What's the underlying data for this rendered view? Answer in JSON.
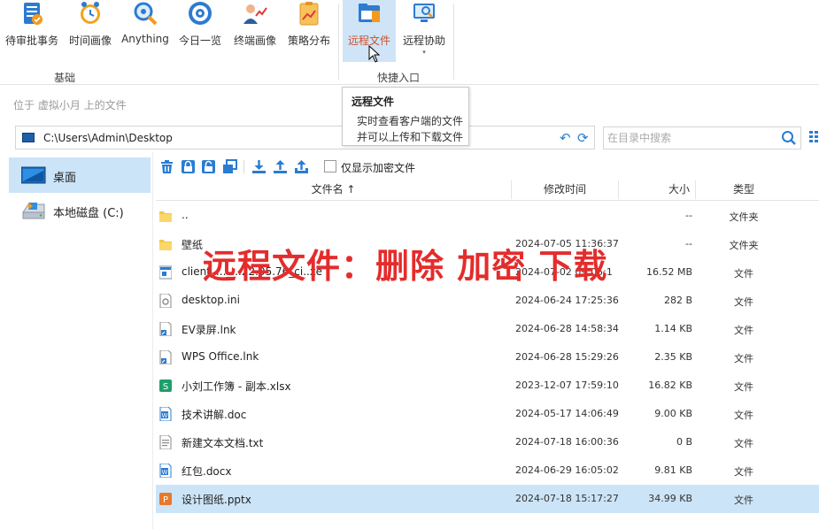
{
  "ribbon": {
    "buttons": [
      {
        "label": "待审批事务",
        "icon": "approval-icon"
      },
      {
        "label": "时间画像",
        "icon": "clock-icon"
      },
      {
        "label": "Anything",
        "icon": "search-magnifier-icon"
      },
      {
        "label": "今日一览",
        "icon": "eye-icon"
      },
      {
        "label": "终端画像",
        "icon": "user-chart-icon"
      },
      {
        "label": "策略分布",
        "icon": "clipboard-chart-icon"
      },
      {
        "label": "远程文件",
        "icon": "remote-file-icon"
      },
      {
        "label": "远程协助",
        "icon": "remote-assist-icon"
      }
    ],
    "groups": [
      "基础",
      "快捷入口"
    ],
    "dropdown_arrow": "▾"
  },
  "tooltip": {
    "title": "远程文件",
    "lines": [
      "实时查看客户端的文件",
      "并可以上传和下载文件"
    ]
  },
  "location_text": "位于 虚拟小月 上的文件",
  "path": {
    "value": "C:\\Users\\Admin\\Desktop",
    "back_icon": "↶",
    "refresh_icon": "⟳"
  },
  "search": {
    "placeholder": "在目录中搜索"
  },
  "sidebar": {
    "items": [
      {
        "label": "桌面",
        "icon": "desktop-icon"
      },
      {
        "label": "本地磁盘 (C:)",
        "icon": "drive-icon"
      }
    ]
  },
  "toolbar": {
    "icons": [
      "delete-icon",
      "lock-icon",
      "unlock-icon",
      "copy-icon",
      "download-icon",
      "upload-icon",
      "upload-folder-icon"
    ],
    "encrypt_only_label": "仅显示加密文件"
  },
  "table": {
    "headers": {
      "name": "文件名 ↑",
      "date": "修改时间",
      "size": "大小",
      "type": "类型"
    },
    "rows": [
      {
        "name": "..",
        "date": "",
        "size": "--",
        "type": "文件夹",
        "icon": "folder-icon"
      },
      {
        "name": "壁纸",
        "date": "2024-07-05 11:36:37",
        "size": "--",
        "type": "文件夹",
        "icon": "folder-icon"
      },
      {
        "name": "client_..._...22.05.76_ci..xe",
        "date": "2024-07-02 09:05:1",
        "size": "16.52 MB",
        "type": "文件",
        "icon": "exe-file-icon"
      },
      {
        "name": "desktop.ini",
        "date": "2024-06-24 17:25:36",
        "size": "282 B",
        "type": "文件",
        "icon": "ini-file-icon"
      },
      {
        "name": "EV录屏.lnk",
        "date": "2024-06-28 14:58:34",
        "size": "1.14 KB",
        "type": "文件",
        "icon": "shortcut-file-icon"
      },
      {
        "name": "WPS Office.lnk",
        "date": "2024-06-28 15:29:26",
        "size": "2.35 KB",
        "type": "文件",
        "icon": "shortcut-file-icon"
      },
      {
        "name": "小刘工作簿 - 副本.xlsx",
        "date": "2023-12-07 17:59:10",
        "size": "16.82 KB",
        "type": "文件",
        "icon": "excel-file-icon"
      },
      {
        "name": "技术讲解.doc",
        "date": "2024-05-17 14:06:49",
        "size": "9.00 KB",
        "type": "文件",
        "icon": "word-file-icon"
      },
      {
        "name": "新建文本文档.txt",
        "date": "2024-07-18 16:00:36",
        "size": "0 B",
        "type": "文件",
        "icon": "text-file-icon"
      },
      {
        "name": "红包.docx",
        "date": "2024-06-29 16:05:02",
        "size": "9.81 KB",
        "type": "文件",
        "icon": "word-file-icon"
      },
      {
        "name": "设计图纸.pptx",
        "date": "2024-07-18 15:17:27",
        "size": "34.99 KB",
        "type": "文件",
        "icon": "ppt-file-icon"
      }
    ]
  },
  "overlay_caption": "远程文件：删除 加密 下载",
  "colors": {
    "selected_bg": "#cce4f7",
    "active_label": "#d0502b",
    "accent_blue": "#2a7cd2",
    "overlay_red": "#e42c2c"
  }
}
